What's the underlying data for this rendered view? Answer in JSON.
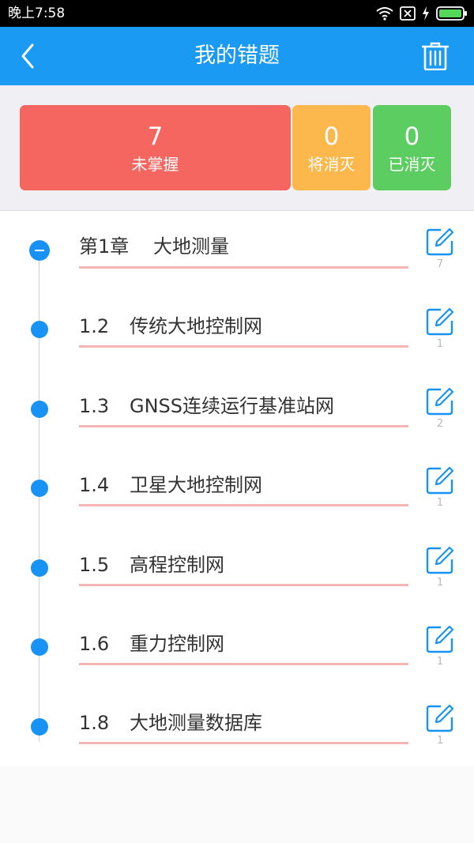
{
  "status_bar": {
    "time": "晚上7:58"
  },
  "header": {
    "title": "我的错题",
    "back_icon": "chevron-left-icon",
    "trash_icon": "trash-icon",
    "background_color": "#1a9af2"
  },
  "summary": {
    "unmastered": {
      "count": "7",
      "label": "未掌握",
      "color": "#f4665f"
    },
    "eliminating": {
      "count": "0",
      "label": "将消灭",
      "color": "#fcb84c"
    },
    "eliminated": {
      "count": "0",
      "label": "已消灭",
      "color": "#5ccd60"
    }
  },
  "chapters": [
    {
      "number": "第1章",
      "title": "大地测量",
      "count": "7"
    },
    {
      "number": "1.2",
      "title": "传统大地控制网",
      "count": "1"
    },
    {
      "number": "1.3",
      "title": "GNSS连续运行基准站网",
      "count": "2"
    },
    {
      "number": "1.4",
      "title": "卫星大地控制网",
      "count": "1"
    },
    {
      "number": "1.5",
      "title": "高程控制网",
      "count": "1"
    },
    {
      "number": "1.6",
      "title": "重力控制网",
      "count": "1"
    },
    {
      "number": "1.8",
      "title": "大地测量数据库",
      "count": "1"
    }
  ],
  "accent_color": "#1893f5",
  "underline_color": "#f5b5b4"
}
